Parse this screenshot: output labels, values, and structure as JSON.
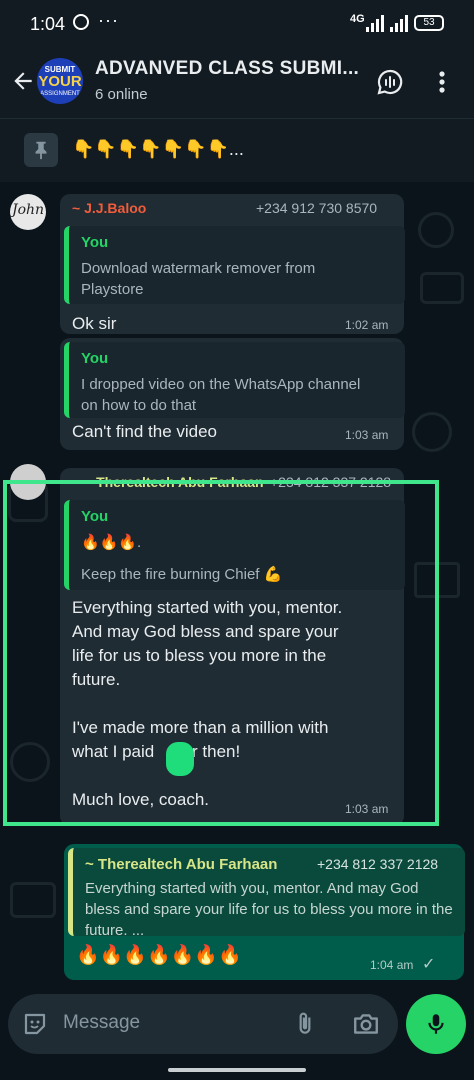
{
  "status_bar": {
    "time": "1:04",
    "network": "4G",
    "battery": "53",
    "notification_dots": "···"
  },
  "header": {
    "title": "ADVANVED CLASS SUBMI...",
    "subtitle": "6 online",
    "avatar_logo": {
      "line1": "SUBMIT",
      "line2": "YOUR",
      "line3": "ASSIGNMENT"
    }
  },
  "pinned": {
    "text": "👇👇👇👇👇👇👇..."
  },
  "messages": [
    {
      "sender": "~ J.J.Baloo",
      "sender_color": "#f15c3a",
      "phone": "+234 912 730 8570",
      "avatar_text": "John",
      "quote": {
        "name": "You",
        "text": "Download watermark remover from Playstore"
      },
      "text": "Ok sir",
      "time": "1:02 am"
    },
    {
      "quote": {
        "name": "You",
        "text": "I dropped video on the WhatsApp channel on how to do that"
      },
      "text": "Can't find the video",
      "time": "1:03 am"
    },
    {
      "sender": "~ Therealtech Abu Farhaan",
      "sender_color": "#d6e687",
      "phone": "+234 812 337 2128",
      "quote": {
        "name": "You",
        "emoji_line": "🔥🔥🔥.",
        "text": "Keep the fire burning Chief 💪"
      },
      "text_lines": [
        "Everything started with you, mentor.",
        "And may God bless and spare your",
        "life for us to bless you more in the",
        "future."
      ],
      "text_lines_2": [
        "I've made more than a million with",
        "what I paid     for then!"
      ],
      "text_line_3": "Much love, coach.",
      "time": "1:03 am"
    },
    {
      "outgoing": true,
      "quote": {
        "name": "~ Therealtech Abu Farhaan",
        "phone": "+234 812 337 2128",
        "text": "Everything started with you, mentor.  And may God bless and spare your life for us to bless you more in the future. ..."
      },
      "text": "🔥🔥🔥🔥🔥🔥🔥",
      "time": "1:04 am",
      "status": "✓"
    }
  ],
  "input": {
    "placeholder": "Message"
  },
  "colors": {
    "accent": "#25d366",
    "bubble_in": "#1f2c34",
    "bubble_out": "#005c4b",
    "bg": "#0b141a",
    "highlight": "#3fe68b"
  },
  "icons": [
    "back-arrow-icon",
    "voice-chat-icon",
    "more-vert-icon",
    "pin-icon",
    "sticker-icon",
    "attach-icon",
    "camera-icon",
    "mic-icon",
    "read-check-icon"
  ]
}
